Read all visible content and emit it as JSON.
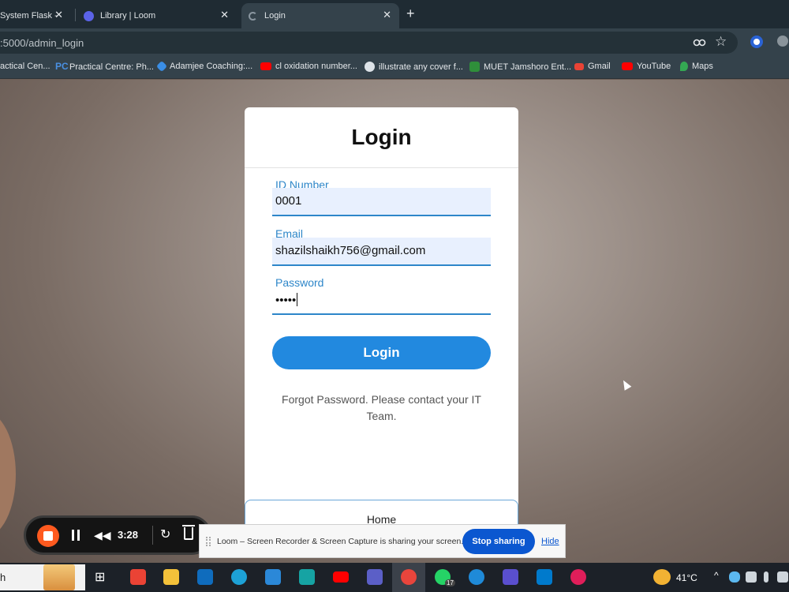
{
  "browser": {
    "tabs": [
      {
        "title": "System Flask -",
        "active": false
      },
      {
        "title": "Library | Loom",
        "active": false
      },
      {
        "title": "Login",
        "active": true
      }
    ],
    "new_tab_symbol": "+",
    "close_symbol": "✕",
    "url": ":5000/admin_login",
    "bookmarks": [
      {
        "label": "actical Cen...",
        "icon": "document-icon"
      },
      {
        "label": "Practical Centre: Ph...",
        "icon": "pc-icon"
      },
      {
        "label": "Adamjee Coaching:...",
        "icon": "diamond-icon"
      },
      {
        "label": "cl oxidation number...",
        "icon": "youtube-icon"
      },
      {
        "label": "illustrate any cover f...",
        "icon": "globe-icon"
      },
      {
        "label": "MUET Jamshoro Ent...",
        "icon": "muet-icon"
      },
      {
        "label": "Gmail",
        "icon": "gmail-icon"
      },
      {
        "label": "YouTube",
        "icon": "youtube-icon"
      },
      {
        "label": "Maps",
        "icon": "maps-icon"
      }
    ]
  },
  "login": {
    "title": "Login",
    "id_label": "ID Number",
    "id_value": "0001",
    "email_label": "Email",
    "email_value": "shazilshaikh756@gmail.com",
    "password_label": "Password",
    "password_value": "•••••",
    "button_label": "Login",
    "forgot_text": "Forgot Password. Please contact your IT Team.",
    "home_label": "Home"
  },
  "loom": {
    "time": "3:28",
    "share_text": "Loom – Screen Recorder & Screen Capture is sharing your screen.",
    "stop_label": "Stop sharing",
    "hide_label": "Hide"
  },
  "taskbar": {
    "search_text": "h",
    "temperature": "41°C",
    "whatsapp_badge": "17",
    "colors": {
      "gmail": "#ea4335",
      "files": "#f3c13a",
      "outlook": "#0f6cbd",
      "edge": "#1da1d6",
      "store": "#2b88d8",
      "pearson": "#16a3a3",
      "youtube": "#ff0000",
      "teams": "#5b5fc7",
      "chrome": "#e8453c",
      "whatsapp": "#25d366",
      "edge2": "#1f8ad8",
      "fandom": "#5a4fcf",
      "vscode": "#007acc",
      "slack": "#e01e5a"
    }
  }
}
